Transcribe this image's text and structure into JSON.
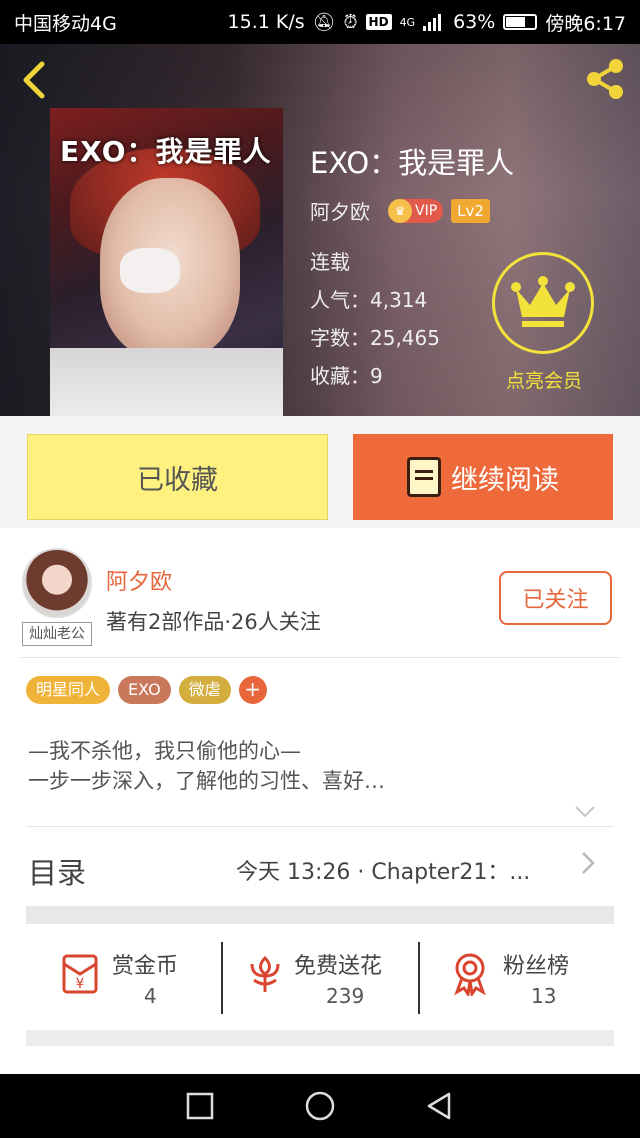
{
  "status_bar": {
    "carrier": "中国移动4G",
    "speed": "15.1 K/s",
    "hd": "HD",
    "network": "4G",
    "battery": "63%",
    "time": "傍晚6:17"
  },
  "book": {
    "cover_text": "EXO：我是罪人",
    "title": "EXO：我是罪人",
    "author": "阿夕欧",
    "vip_label": "VIP",
    "level_label": "Lv2",
    "status": "连载",
    "popularity": "人气：4,314",
    "word_count": "字数：25,465",
    "favorites": "收藏：9"
  },
  "member": {
    "label": "点亮会员"
  },
  "actions": {
    "favorited_label": "已收藏",
    "continue_label": "继续阅读"
  },
  "author_card": {
    "avatar_tag": "灿灿老公",
    "name": "阿夕欧",
    "stats": "著有2部作品·26人关注",
    "follow_label": "已关注"
  },
  "tags": [
    {
      "label": "明星同人",
      "color": "#f0b33a"
    },
    {
      "label": "EXO",
      "color": "#c9785c"
    },
    {
      "label": "微虐",
      "color": "#d3ad3e"
    }
  ],
  "tag_add": "+",
  "description": {
    "line1": "—我不杀他，我只偷他的心—",
    "line2": "一步一步深入，了解他的习性、喜好…"
  },
  "toc": {
    "label": "目录",
    "latest": "今天 13:26 · Chapter21：..."
  },
  "stats": {
    "reward": {
      "label": "赏金币",
      "value": "4"
    },
    "flowers": {
      "label": "免费送花",
      "value": "239"
    },
    "fans": {
      "label": "粉丝榜",
      "value": "13"
    }
  },
  "colors": {
    "accent": "#e8663b",
    "favorite_button": "#fef17f",
    "read_button": "#ef6a3b",
    "member_yellow": "#f3e23a",
    "icon_red": "#d9452e"
  }
}
